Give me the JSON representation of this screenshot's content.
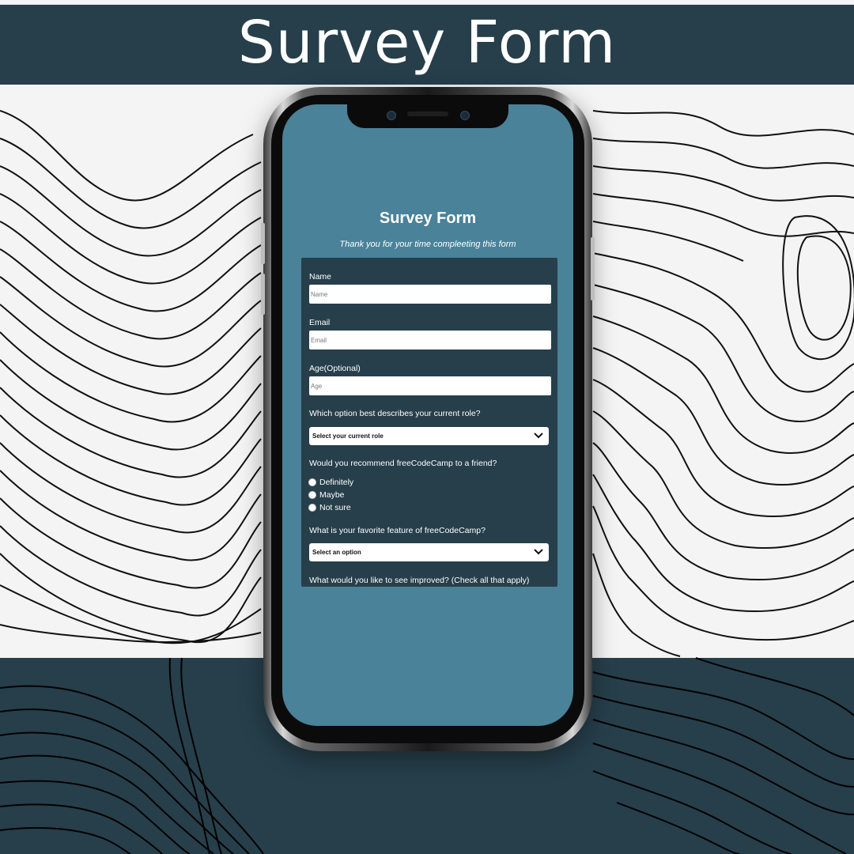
{
  "banner": {
    "title": "Survey Form"
  },
  "form": {
    "title": "Survey Form",
    "subtitle": "Thank you for your time compleeting this form",
    "fields": [
      {
        "label": "Name",
        "placeholder": "Name"
      },
      {
        "label": "Email",
        "placeholder": "Email"
      },
      {
        "label": "Age(Optional)",
        "placeholder": "Age"
      }
    ],
    "role": {
      "label": "Which option best describes your current role?",
      "selected": "Select your current role"
    },
    "recommend": {
      "label": "Would you recommend freeCodeCamp to a friend?",
      "options": [
        "Definitely",
        "Maybe",
        "Not sure"
      ]
    },
    "feature": {
      "label": "What is your favorite feature of freeCodeCamp?",
      "selected": "Select an option"
    },
    "improve": {
      "label": "What would you like to see improved? (Check all that apply)"
    }
  },
  "icons": {
    "dropdown": "chevron-down-icon",
    "camera": "camera-icon"
  },
  "colors": {
    "banner": "#263f4b",
    "screen": "#4a8299",
    "card": "#263f4b",
    "bottom_band": "#263f4b"
  }
}
